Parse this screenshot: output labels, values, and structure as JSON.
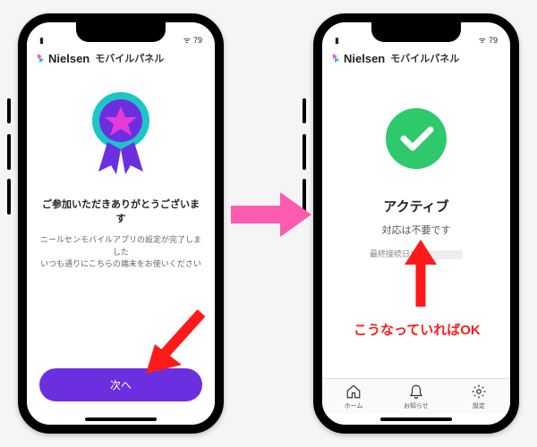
{
  "brand": "Nielsen",
  "app_title": "モバイルパネル",
  "status": {
    "battery": "79"
  },
  "screen1": {
    "thanks_title": "ご参加いただきありがとうございます",
    "thanks_desc_l1": "ニールセンモバイルアプリの設定が完了しました",
    "thanks_desc_l2": "いつも通りにこちらの端末をお使いください",
    "next_button": "次へ"
  },
  "screen2": {
    "active_title": "アクティブ",
    "active_sub": "対応は不要です",
    "last_conn_label": "最終接続日：",
    "tabs": {
      "home": "ホーム",
      "notice": "お知らせ",
      "settings": "設定"
    }
  },
  "annotation": "こうなっていればOK",
  "colors": {
    "primary_purple": "#6b2fe0",
    "badge_teal": "#1cc6c6",
    "badge_star": "#e63bd6",
    "check_green": "#2ec96b",
    "arrow_pink": "#ff5bb0",
    "arrow_red": "#ff1a1a"
  }
}
